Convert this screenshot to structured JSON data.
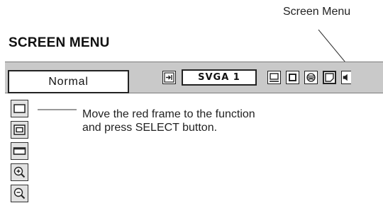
{
  "callout": {
    "label": "Screen Menu"
  },
  "header": {
    "title": "SCREEN MENU"
  },
  "menubar": {
    "mode_value": "Normal",
    "source_value": "SVGA 1",
    "icons": [
      "input-source-icon",
      "position-icon",
      "keystone-icon",
      "image-adjust-icon",
      "screen-menu-icon",
      "sound-icon"
    ]
  },
  "side_menu": {
    "items": [
      "normal-frame-icon",
      "true-frame-icon",
      "wide-frame-icon",
      "digital-zoom-plus-icon",
      "digital-zoom-minus-icon"
    ]
  },
  "instruction": {
    "line1": "Move the red frame to the function",
    "line2": "and press SELECT button."
  }
}
